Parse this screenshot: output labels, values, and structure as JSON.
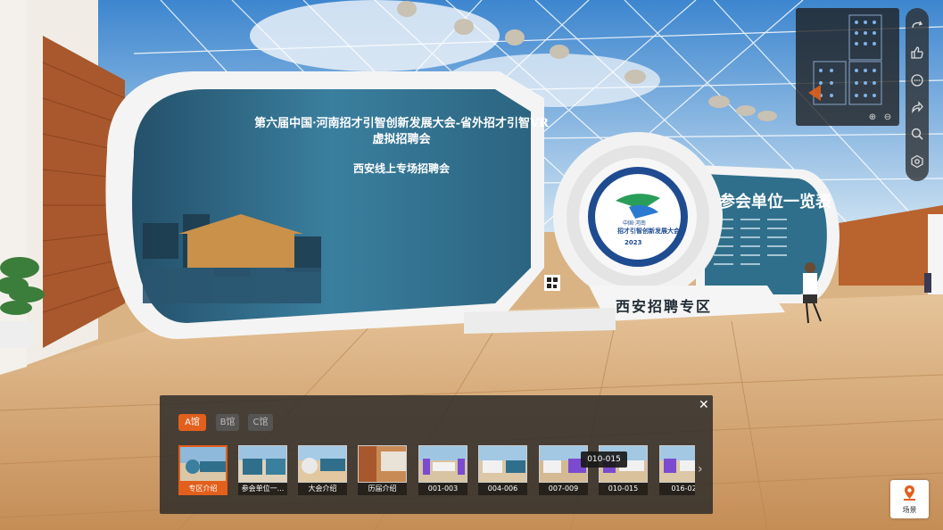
{
  "banner": {
    "title": "第六届中国·河南招才引智创新发展大会-省外招才引智VR虚拟招聘会",
    "subtitle": "西安线上专场招聘会"
  },
  "participants_title": "参会单位一览表",
  "zone_label": "西安招聘专区",
  "logo": {
    "line1": "中国·河南",
    "line2": "招才引智创新发展大会",
    "year": "2023",
    "ring": "Henan-China"
  },
  "minimap": {
    "zoom_in_icon": "zoom-in-icon",
    "zoom_out_icon": "zoom-out-icon"
  },
  "toolbar": [
    "rotate-icon",
    "like-icon",
    "comment-icon",
    "share-icon",
    "search-icon",
    "settings-icon"
  ],
  "hall_panel": {
    "tabs": [
      {
        "label": "A馆",
        "active": true
      },
      {
        "label": "B馆",
        "active": false
      },
      {
        "label": "C馆",
        "active": false
      }
    ],
    "thumbnails": [
      {
        "label": "专区介绍",
        "active": true
      },
      {
        "label": "参会单位一...",
        "active": false
      },
      {
        "label": "大会介绍",
        "active": false
      },
      {
        "label": "历届介绍",
        "active": false
      },
      {
        "label": "001-003",
        "active": false
      },
      {
        "label": "004-006",
        "active": false
      },
      {
        "label": "007-009",
        "active": false
      },
      {
        "label": "010-015",
        "active": false
      },
      {
        "label": "016-02",
        "active": false
      }
    ],
    "tooltip": "010-015"
  },
  "scene_button": {
    "label": "场景"
  },
  "colors": {
    "accent": "#e25f1c",
    "panel_bg": "#2b2b2b",
    "banner_teal": "#2e6a86"
  }
}
